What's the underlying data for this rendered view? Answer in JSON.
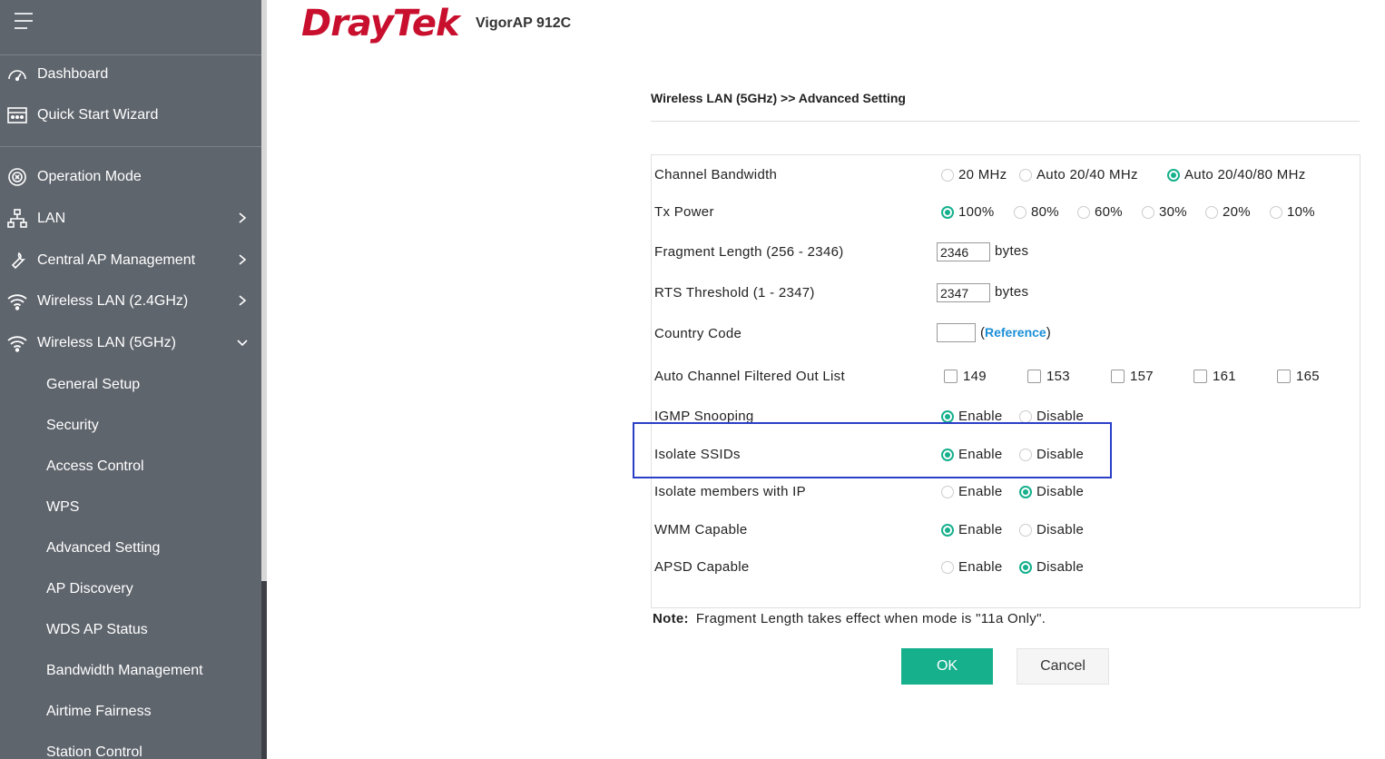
{
  "header": {
    "logo": "DrayTek",
    "model": "VigorAP 912C"
  },
  "sidebar": {
    "items": [
      {
        "label": "Dashboard"
      },
      {
        "label": "Quick Start Wizard"
      },
      {
        "label": "Operation Mode"
      },
      {
        "label": "LAN"
      },
      {
        "label": "Central AP Management"
      },
      {
        "label": "Wireless LAN (2.4GHz)"
      },
      {
        "label": "Wireless LAN (5GHz)"
      }
    ],
    "subitems": [
      {
        "label": "General Setup"
      },
      {
        "label": "Security"
      },
      {
        "label": "Access Control"
      },
      {
        "label": "WPS"
      },
      {
        "label": "Advanced Setting"
      },
      {
        "label": "AP Discovery"
      },
      {
        "label": "WDS AP Status"
      },
      {
        "label": "Bandwidth Management"
      },
      {
        "label": "Airtime Fairness"
      },
      {
        "label": "Station Control"
      }
    ]
  },
  "page": {
    "title": "Wireless LAN (5GHz) >> Advanced Setting"
  },
  "form": {
    "channel_bandwidth": {
      "label": "Channel Bandwidth",
      "options": [
        "20 MHz",
        "Auto 20/40 MHz",
        "Auto 20/40/80 MHz"
      ],
      "selected": "Auto 20/40/80 MHz"
    },
    "tx_power": {
      "label": "Tx Power",
      "options": [
        "100%",
        "80%",
        "60%",
        "30%",
        "20%",
        "10%"
      ],
      "selected": "100%"
    },
    "fragment_length": {
      "label": "Fragment Length (256 - 2346)",
      "value": "2346",
      "unit": "bytes"
    },
    "rts_threshold": {
      "label": "RTS Threshold (1 - 2347)",
      "value": "2347",
      "unit": "bytes"
    },
    "country_code": {
      "label": "Country Code",
      "value": "",
      "open_paren": "(",
      "link": "Reference",
      "close_paren": ")"
    },
    "auto_channel": {
      "label": "Auto Channel Filtered Out List",
      "channels": [
        "149",
        "153",
        "157",
        "161",
        "165"
      ]
    },
    "igmp_snooping": {
      "label": "IGMP Snooping",
      "enable": "Enable",
      "disable": "Disable",
      "selected": "Enable"
    },
    "isolate_ssids": {
      "label": "Isolate SSIDs",
      "enable": "Enable",
      "disable": "Disable",
      "selected": "Enable"
    },
    "isolate_members": {
      "label": "Isolate members with IP",
      "enable": "Enable",
      "disable": "Disable",
      "selected": "Disable"
    },
    "wmm": {
      "label": "WMM Capable",
      "enable": "Enable",
      "disable": "Disable",
      "selected": "Enable"
    },
    "apsd": {
      "label": "APSD Capable",
      "enable": "Enable",
      "disable": "Disable",
      "selected": "Disable"
    }
  },
  "note": {
    "label": "Note:",
    "text": "Fragment Length takes effect when mode is \"11a Only\"."
  },
  "buttons": {
    "ok": "OK",
    "cancel": "Cancel"
  },
  "colors": {
    "accent": "#16b08d",
    "sidebar_bg": "#5f656d",
    "brand": "#c8102e",
    "link": "#1a8fd8",
    "highlight_box": "#2a3fc7"
  }
}
